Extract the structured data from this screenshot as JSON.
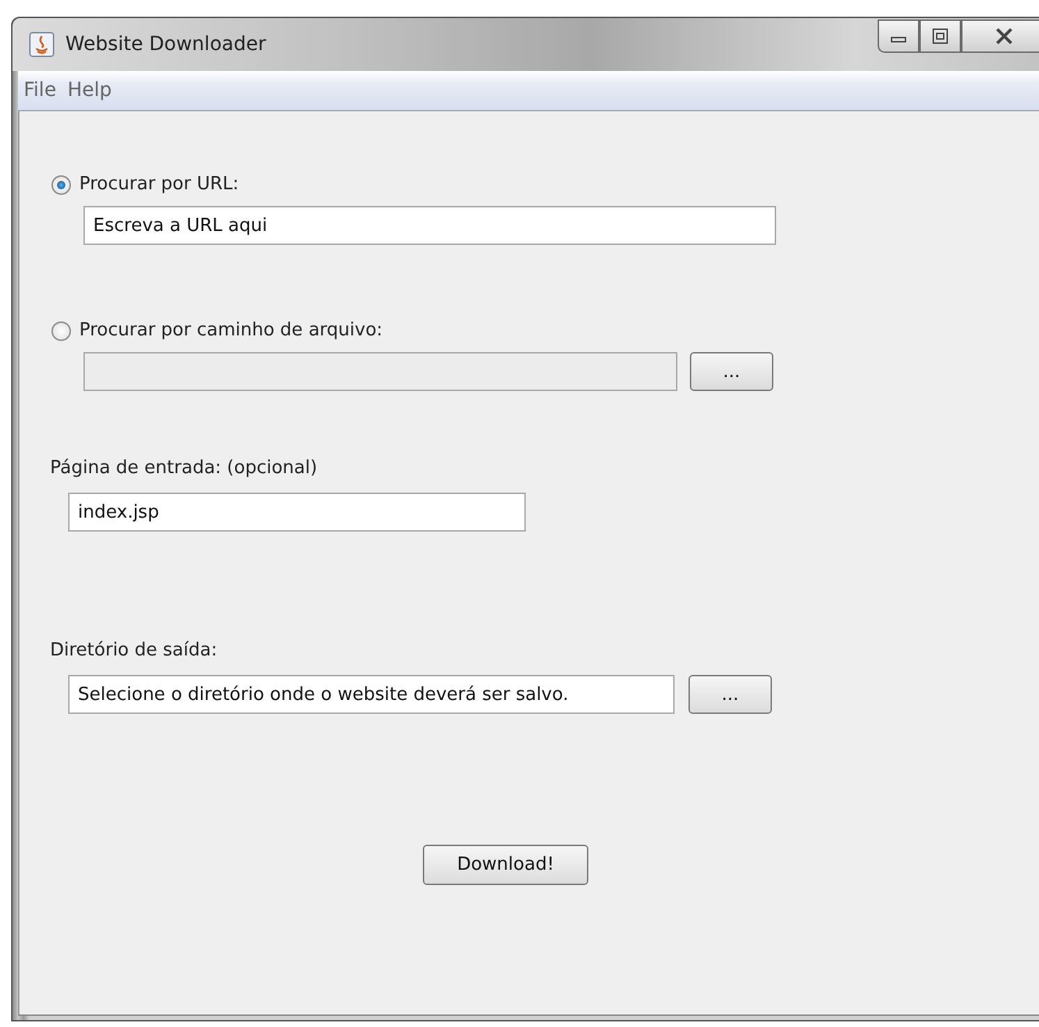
{
  "window": {
    "title": "Website Downloader"
  },
  "menu": [
    "File",
    "Help"
  ],
  "source_options": [
    {
      "label": "Procurar por URL:",
      "selected": true,
      "field": {
        "value": "Escreva a URL aqui",
        "disabled": false
      }
    },
    {
      "label": "Procurar por caminho de arquivo:",
      "selected": false,
      "field": {
        "disabled": true
      },
      "browse_button": "..."
    }
  ],
  "entry_page": {
    "label": "Página de entrada: (opcional)",
    "value": "index.jsp"
  },
  "output_dir": {
    "label": "Diretório de saída:",
    "value": "Selecione o diretório onde o website deverá ser salvo.",
    "browse_button": "..."
  },
  "download_button": "Download!"
}
